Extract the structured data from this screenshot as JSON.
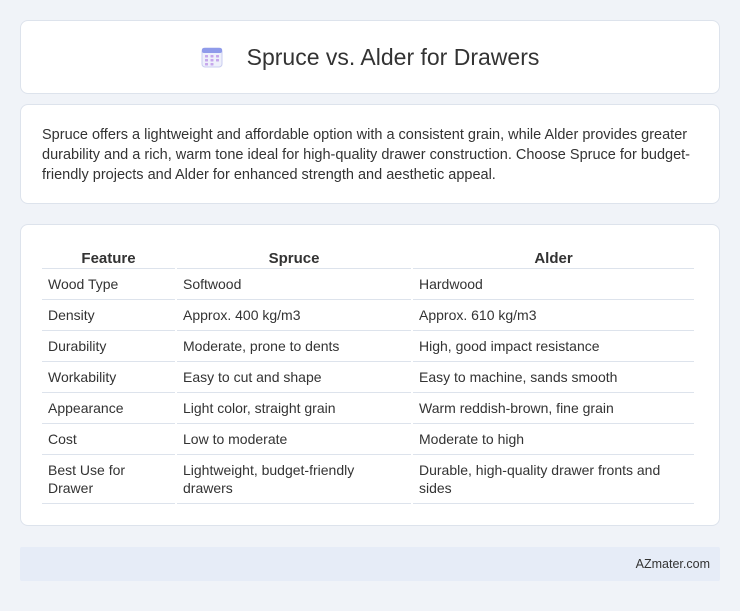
{
  "header": {
    "title": "Spruce vs. Alder for Drawers",
    "icon": "calendar-icon"
  },
  "summary": {
    "text": "Spruce offers a lightweight and affordable option with a consistent grain, while Alder provides greater durability and a rich, warm tone ideal for high-quality drawer construction. Choose Spruce for budget-friendly projects and Alder for enhanced strength and aesthetic appeal."
  },
  "table": {
    "headers": [
      "Feature",
      "Spruce",
      "Alder"
    ],
    "rows": [
      [
        "Wood Type",
        "Softwood",
        "Hardwood"
      ],
      [
        "Density",
        "Approx. 400 kg/m3",
        "Approx. 610 kg/m3"
      ],
      [
        "Durability",
        "Moderate, prone to dents",
        "High, good impact resistance"
      ],
      [
        "Workability",
        "Easy to cut and shape",
        "Easy to machine, sands smooth"
      ],
      [
        "Appearance",
        "Light color, straight grain",
        "Warm reddish-brown, fine grain"
      ],
      [
        "Cost",
        "Low to moderate",
        "Moderate to high"
      ],
      [
        "Best Use for Drawer",
        "Lightweight, budget-friendly drawers",
        "Durable, high-quality drawer fronts and sides"
      ]
    ]
  },
  "footer": {
    "brand": "AZmater.com"
  }
}
